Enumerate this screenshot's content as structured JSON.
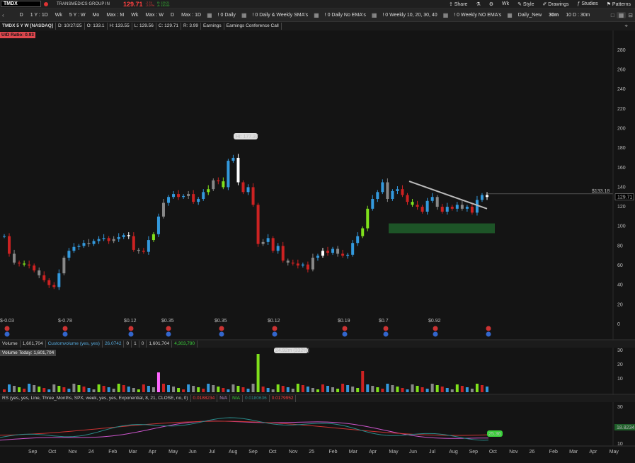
{
  "top": {
    "symbol": "TMDX",
    "company": "TRANSMEDICS GROUP IN",
    "last": "129.71",
    "change_pct": "-2.07%",
    "change_abs": "-2.74",
    "bid": "B: 129.21",
    "ask": "A: 130.00",
    "share": "Share",
    "wk": "Wk",
    "style": "Style",
    "drawings": "Drawings",
    "studies": "Studies",
    "patterns": "Patterns"
  },
  "toolbar": {
    "items": [
      "D",
      "1 Y : 1D",
      "Wk",
      "5 Y : W",
      "Mo",
      "Max : M",
      "Wk",
      "Max : W",
      "D",
      "Max : 1D"
    ],
    "sets": [
      "! 0 Daily",
      "! 0 Daily & Weekly SMA's",
      "! 0 Daily No EMA's",
      "! 0 Weekly 10, 20, 30, 40",
      "! 0 Weekly NO EMA's",
      "Daily_New"
    ],
    "intraday": [
      "30m",
      "10 D : 30m"
    ]
  },
  "info": {
    "title": "TMDX 5 Y W [NASDAQ]",
    "date": "D: 10/27/25",
    "open": "O: 133.1",
    "high": "H: 133.55",
    "low": "L: 129.56",
    "close": "C: 129.71",
    "range": "R: 3.99",
    "earnings": "Earnings",
    "conf": "Earnings Conference Call",
    "ud_ratio": "U/D Ratio: 0.93"
  },
  "price_axis": [
    "280",
    "260",
    "240",
    "220",
    "200",
    "180",
    "160",
    "140",
    "120",
    "100",
    "80",
    "60",
    "40",
    "20",
    "0"
  ],
  "annotations": {
    "hi": "Hi: 177.37",
    "level": "$133.18",
    "price_tag": "129.71",
    "earnings_labels": [
      "$-0.03",
      "$-0.78",
      "$0.12",
      "$0.35",
      "$0.35",
      "$0.12",
      "$0.19",
      "$0.7",
      "$0.92"
    ]
  },
  "volume": {
    "header": [
      "Volume",
      "1,601,704",
      "Customvolume (yes, yes)",
      "26.0742",
      "0",
      "1",
      "0",
      "1,601,704",
      "4,303,790"
    ],
    "today": "Volume Today: 1,601,704",
    "peak": "24.92m (332%)",
    "axis": [
      "30",
      "20",
      "10"
    ]
  },
  "rs": {
    "header": [
      "RS (yes, yes, Line, Three_Months, SPX, week, yes, yes, Exponential, 8, 21, CLOSE, no, 0)",
      "0.0188234",
      "N/A",
      "N/A",
      "0.0180636",
      "0.0179952"
    ],
    "axis": [
      "30",
      "10"
    ],
    "last": "18.8234",
    "green_tag": "25.36"
  },
  "time_axis": [
    "Sep",
    "Oct",
    "Nov",
    "24",
    "Feb",
    "Mar",
    "Apr",
    "May",
    "Jun",
    "Jul",
    "Aug",
    "Sep",
    "Oct",
    "Nov",
    "25",
    "Feb",
    "Mar",
    "Apr",
    "May",
    "Jun",
    "Jul",
    "Aug",
    "Sep",
    "Oct",
    "Nov",
    "26",
    "Feb",
    "Mar",
    "Apr",
    "May"
  ],
  "chart_data": {
    "type": "candlestick",
    "ylim": [
      0,
      290
    ],
    "close": [
      90,
      72,
      63,
      62,
      61,
      60,
      55,
      50,
      45,
      40,
      38,
      52,
      68,
      75,
      79,
      80,
      83,
      82,
      85,
      87,
      88,
      85,
      87,
      89,
      91,
      90,
      76,
      75,
      74,
      86,
      92,
      110,
      124,
      130,
      133,
      130,
      131,
      133,
      125,
      128,
      135,
      138,
      147,
      146,
      140,
      167,
      170,
      145,
      135,
      140,
      122,
      82,
      84,
      88,
      75,
      80,
      65,
      63,
      62,
      60,
      61,
      56,
      68,
      70,
      75,
      73,
      77,
      72,
      70,
      71,
      83,
      90,
      98,
      118,
      128,
      135,
      145,
      128,
      136,
      138,
      132,
      125,
      122,
      120,
      115,
      126,
      130,
      120,
      115,
      120,
      118,
      122,
      118,
      120,
      114,
      127,
      132,
      130
    ]
  },
  "colors": {
    "up": "#3399dd",
    "down": "#cc2222",
    "neutral": "#888888",
    "bright": "#7fe01c",
    "trendline": "#bbbbbb",
    "support": "#1f5f2a"
  }
}
